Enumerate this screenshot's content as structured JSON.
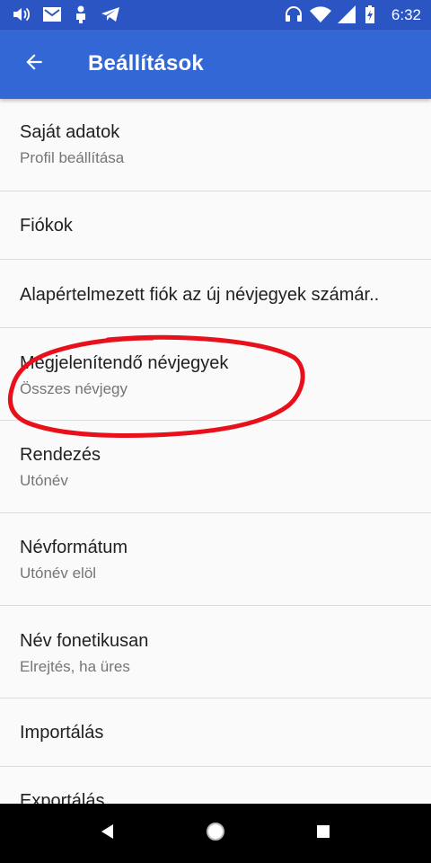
{
  "status_bar": {
    "time": "6:32",
    "left_icons": [
      "volume-icon",
      "gmail-icon",
      "person-icon",
      "telegram-icon"
    ],
    "right_icons": [
      "headphones-icon",
      "wifi-icon",
      "signal-icon",
      "battery-icon"
    ]
  },
  "app_bar": {
    "title": "Beállítások",
    "back_icon": "arrow-back-icon",
    "background": "#3367d6"
  },
  "settings": [
    {
      "title": "Saját adatok",
      "subtitle": "Profil beállítása"
    },
    {
      "title": "Fiókok"
    },
    {
      "title": "Alapértelmezett fiók az új névjegyek számár.."
    },
    {
      "title": "Megjelenítendő névjegyek",
      "subtitle": "Összes névjegy"
    },
    {
      "title": "Rendezés",
      "subtitle": "Utónév"
    },
    {
      "title": "Névformátum",
      "subtitle": "Utónév elöl"
    },
    {
      "title": "Név fonetikusan",
      "subtitle": "Elrejtés, ha üres"
    },
    {
      "title": "Importálás"
    },
    {
      "title": "Exportálás"
    }
  ],
  "annotation": {
    "color": "#e8101a",
    "target": "Megjelenítendő névjegyek"
  },
  "nav_bar": {
    "icons": [
      "back-triangle-icon",
      "home-circle-icon",
      "recents-square-icon"
    ]
  }
}
